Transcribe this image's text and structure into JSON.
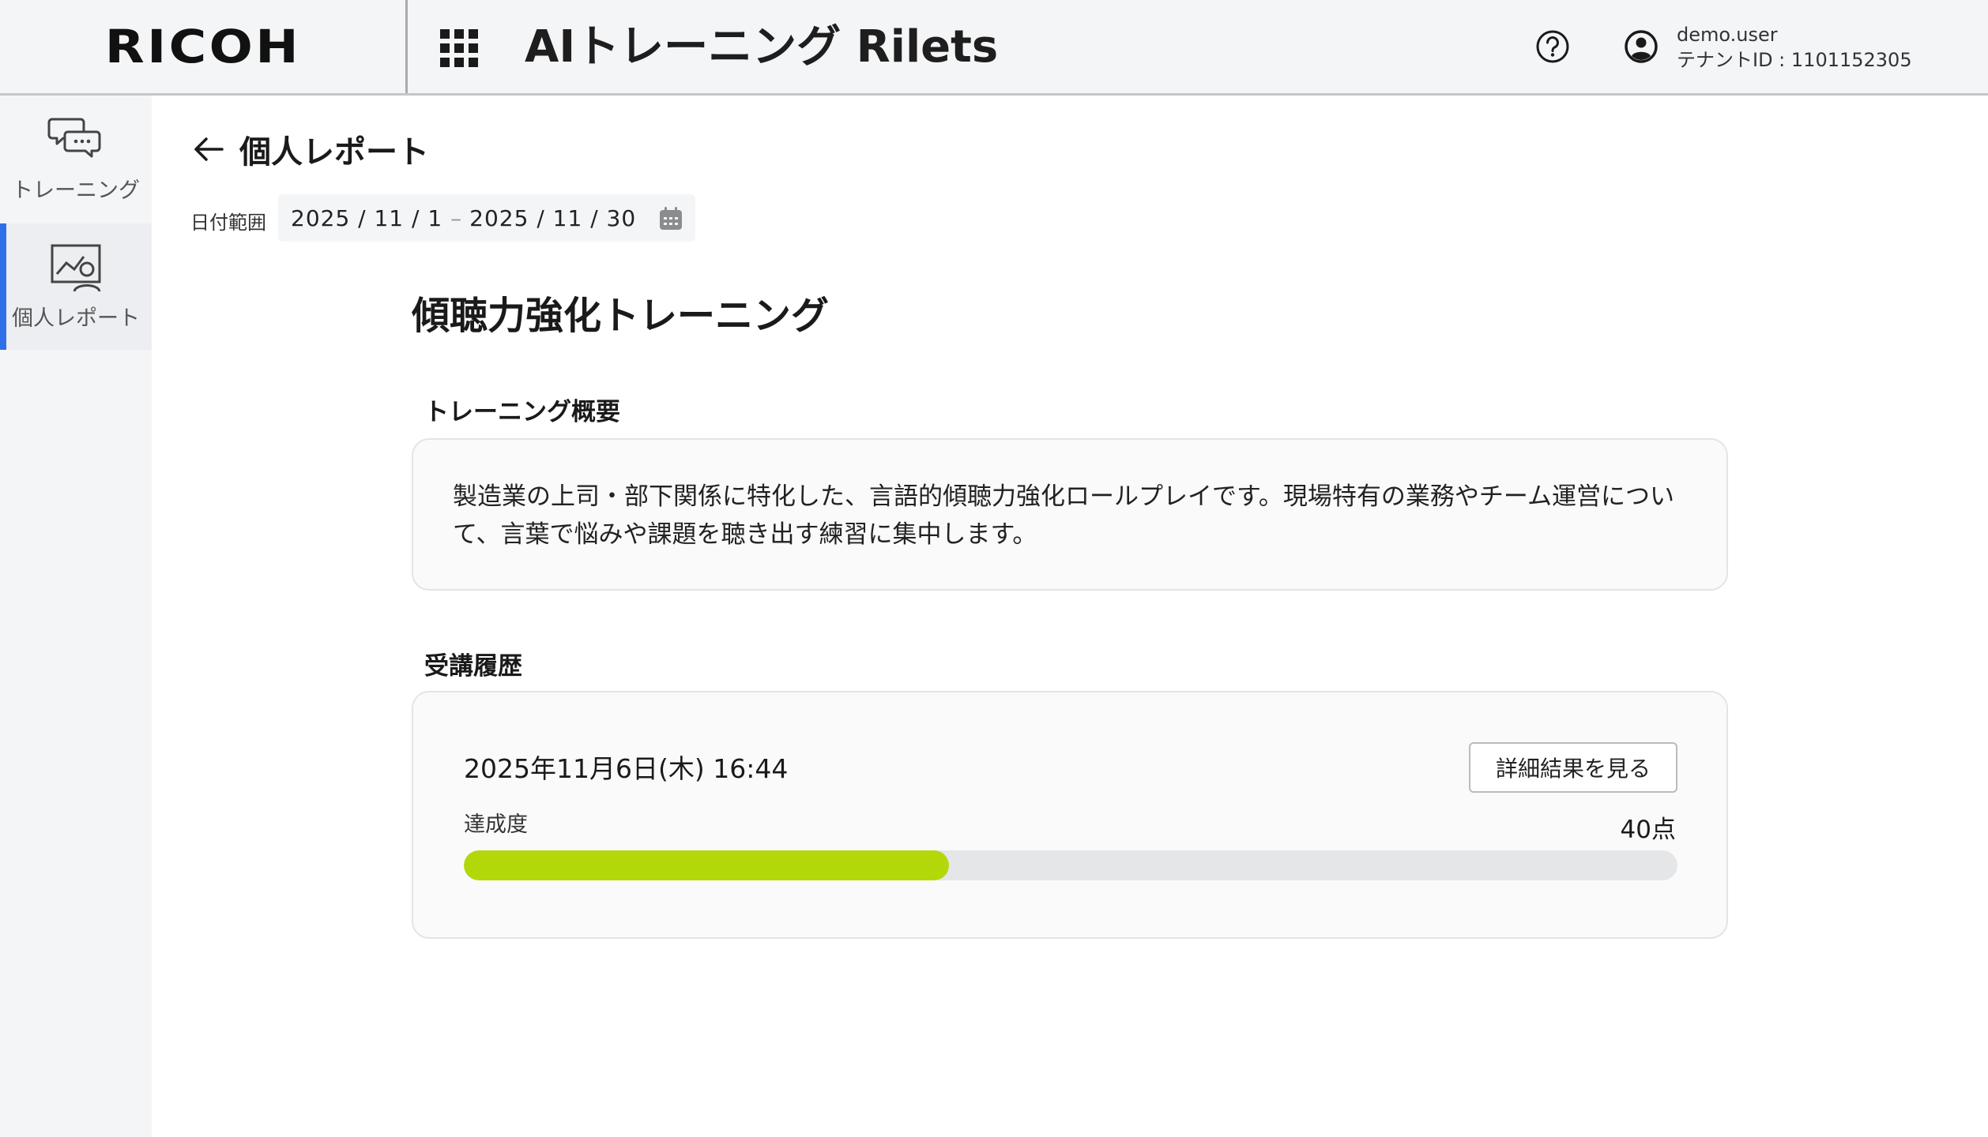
{
  "header": {
    "logo": "RICOH",
    "app_title": "AIトレーニング Rilets",
    "user_name": "demo.user",
    "tenant": "テナントID : 1101152305"
  },
  "sidebar": {
    "items": [
      {
        "label": "トレーニング",
        "icon": "chat-bubbles-icon",
        "active": false
      },
      {
        "label": "個人レポート",
        "icon": "report-person-icon",
        "active": true
      }
    ],
    "active_color": "#2f6fe8"
  },
  "page": {
    "title": "個人レポート",
    "date_range_label": "日付範囲",
    "date_from": "2025 / 11 / 1",
    "date_sep": "–",
    "date_to": "2025 / 11 / 30"
  },
  "course": {
    "title": "傾聴力強化トレーニング",
    "overview_heading": "トレーニング概要",
    "overview_text": "製造業の上司・部下関係に特化した、言語的傾聴力強化ロールプレイです。現場特有の業務やチーム運営について、言葉で悩みや課題を聴き出す練習に集中します。",
    "history_heading": "受講履歴"
  },
  "history": [
    {
      "datetime": "2025年11月6日(木) 16:44",
      "detail_button": "詳細結果を見る",
      "achievement_label": "達成度",
      "score_text": "40点",
      "progress_percent": 40,
      "bar_color": "#b2d80a"
    }
  ]
}
